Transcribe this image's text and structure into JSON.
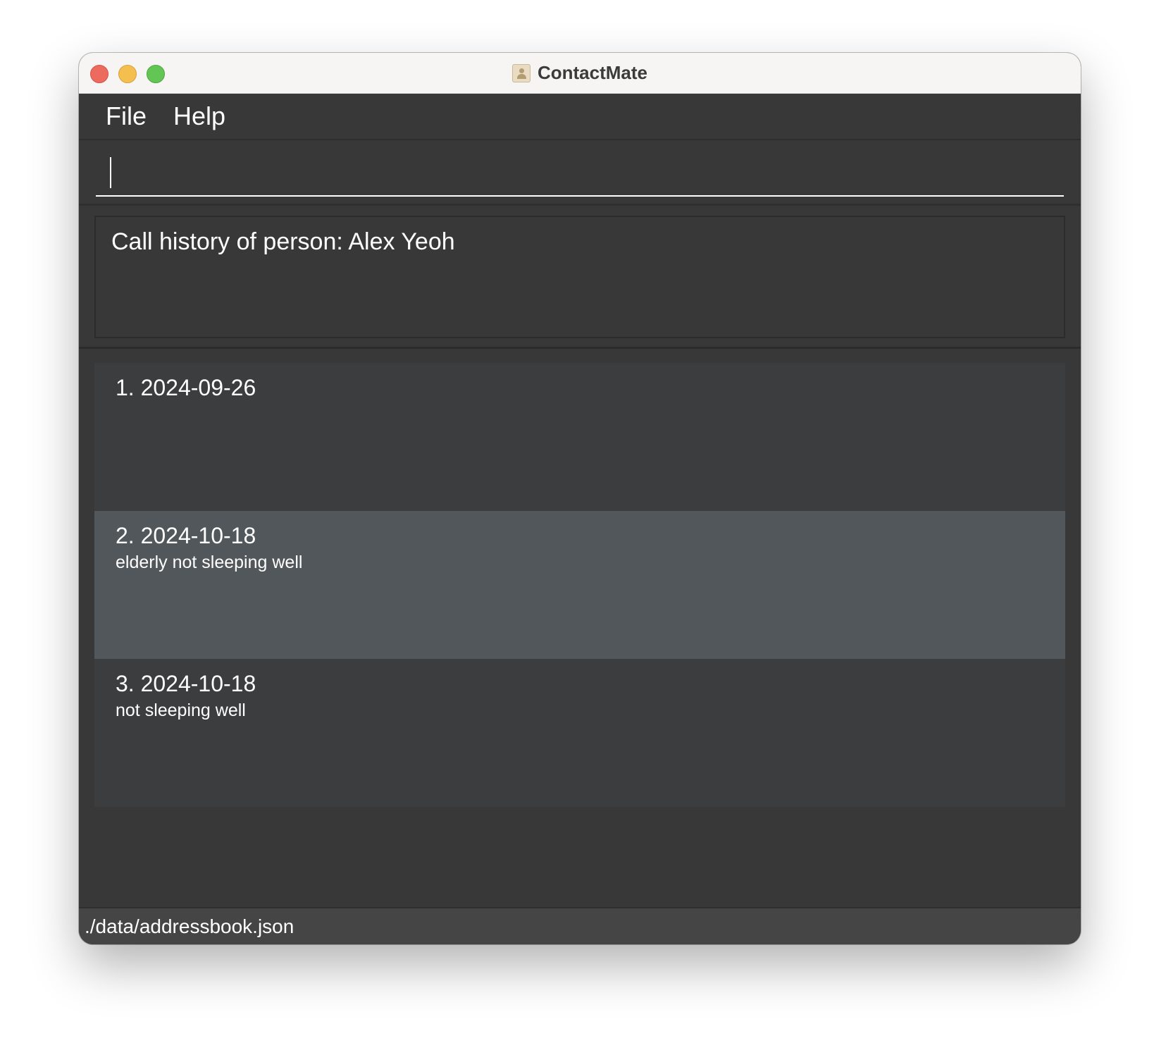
{
  "window": {
    "title": "ContactMate"
  },
  "menu": {
    "file_label": "File",
    "help_label": "Help"
  },
  "command": {
    "value": "",
    "placeholder": ""
  },
  "result": {
    "message": "Call history of person: Alex Yeoh"
  },
  "calls": [
    {
      "header": "1. 2024-09-26",
      "note": ""
    },
    {
      "header": "2. 2024-10-18",
      "note": "elderly not sleeping well"
    },
    {
      "header": "3. 2024-10-18",
      "note": "not sleeping well"
    }
  ],
  "status": {
    "path": "./data/addressbook.json"
  },
  "colors": {
    "background": "#383838",
    "card_odd": "#3c3d3f",
    "card_selected": "#51575a",
    "text": "#ffffff"
  },
  "icons": {
    "app": "contact-book-icon"
  }
}
